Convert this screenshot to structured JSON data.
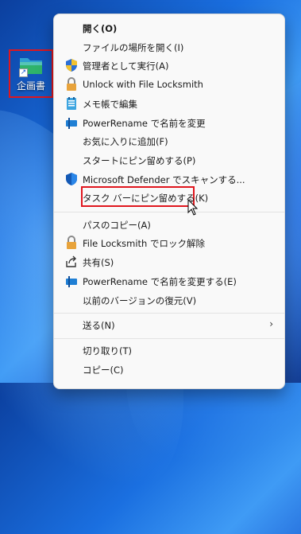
{
  "desktop": {
    "icon_label": "企画書"
  },
  "menu": {
    "items": [
      {
        "label": "開く(O)",
        "icon": "none"
      },
      {
        "label": "ファイルの場所を開く(I)",
        "icon": "none"
      },
      {
        "label": "管理者として実行(A)",
        "icon": "shield-uac-icon"
      },
      {
        "label": "Unlock with File Locksmith",
        "icon": "lock-icon"
      },
      {
        "label": "メモ帳で編集",
        "icon": "notepad-icon"
      },
      {
        "label": "PowerRename で名前を変更",
        "icon": "powerrename-icon"
      },
      {
        "label": "お気に入りに追加(F)",
        "icon": "none"
      },
      {
        "label": "スタートにピン留めする(P)",
        "icon": "none"
      },
      {
        "label": "Microsoft Defender でスキャンする...",
        "icon": "defender-icon"
      },
      {
        "label": "タスク バーにピン留めする(K)",
        "icon": "none"
      },
      {
        "label": "パスのコピー(A)",
        "icon": "none"
      },
      {
        "label": "File Locksmith でロック解除",
        "icon": "lock-icon"
      },
      {
        "label": "共有(S)",
        "icon": "share-icon"
      },
      {
        "label": "PowerRename で名前を変更する(E)",
        "icon": "powerrename-icon"
      },
      {
        "label": "以前のバージョンの復元(V)",
        "icon": "none"
      },
      {
        "label": "送る(N)",
        "icon": "none"
      },
      {
        "label": "切り取り(T)",
        "icon": "none"
      },
      {
        "label": "コピー(C)",
        "icon": "none"
      }
    ],
    "submenu_arrow": "›"
  },
  "colors": {
    "highlight_border": "#e0161e",
    "menu_bg": "#f9f9f9"
  }
}
